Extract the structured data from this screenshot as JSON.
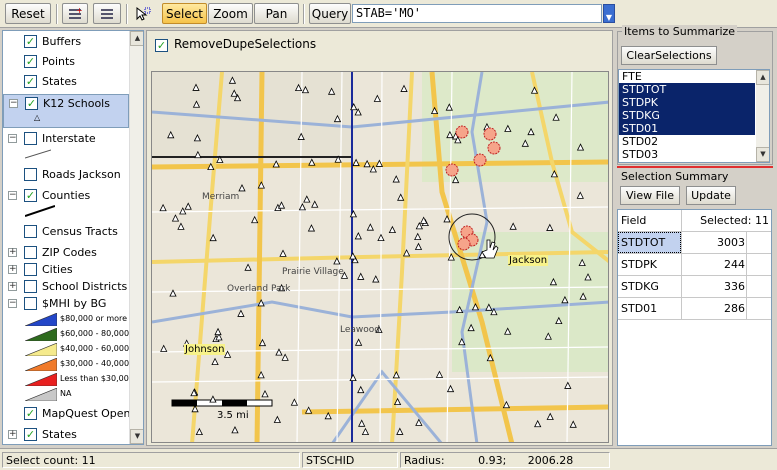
{
  "toolbar": {
    "reset": "Reset",
    "select": "Select",
    "zoom": "Zoom",
    "pan": "Pan",
    "query": "Query",
    "query_value": "STAB='MO'"
  },
  "layers": [
    {
      "label": "Buffers",
      "checked": true
    },
    {
      "label": "Points",
      "checked": true
    },
    {
      "label": "States",
      "checked": true
    },
    {
      "label": "K12 Schools",
      "checked": true
    },
    {
      "label": "Interstate",
      "checked": false
    },
    {
      "label": "Roads Jackson",
      "checked": false
    },
    {
      "label": "Counties",
      "checked": true
    },
    {
      "label": "Census Tracts",
      "checked": false
    },
    {
      "label": "ZIP Codes",
      "checked": false
    },
    {
      "label": "Cities",
      "checked": false
    },
    {
      "label": "School Districts",
      "checked": false
    },
    {
      "label": "$MHI by BG",
      "checked": false
    },
    {
      "label": "MapQuest OpenSt",
      "checked": true
    },
    {
      "label": "States",
      "checked": true
    }
  ],
  "legend": [
    {
      "label": "$80,000 or more",
      "color": "#2346c8"
    },
    {
      "label": "$60,000 - 80,000",
      "color": "#2e6b1e"
    },
    {
      "label": "$40,000 - 60,000",
      "color": "#f5ea8c"
    },
    {
      "label": "$30,000 - 40,000",
      "color": "#f07a2a"
    },
    {
      "label": "Less than $30,000",
      "color": "#e82020"
    },
    {
      "label": "NA",
      "color": "#c8c8c8"
    }
  ],
  "map": {
    "remove_dupe_label": "RemoveDupeSelections",
    "remove_dupe_checked": true,
    "label_johnson": "Johnson",
    "label_jackson": "Jackson",
    "scale_label": "3.5 mi",
    "place_labels": [
      "Merriam",
      "Overland Park",
      "Prairie Village",
      "Leawood"
    ]
  },
  "items": {
    "title": "Items to Summarize",
    "clear_button": "ClearSelections",
    "list": [
      {
        "label": "FTE",
        "selected": false
      },
      {
        "label": "STDTOT",
        "selected": true
      },
      {
        "label": "STDPK",
        "selected": true
      },
      {
        "label": "STDKG",
        "selected": true
      },
      {
        "label": "STD01",
        "selected": true
      },
      {
        "label": "STD02",
        "selected": false
      },
      {
        "label": "STD03",
        "selected": false
      }
    ]
  },
  "summary": {
    "title": "Selection Summary",
    "view_file": "View File",
    "update": "Update",
    "header_field": "Field",
    "header_selected": "Selected: 11",
    "rows": [
      {
        "field": "STDTOT",
        "value": "3003"
      },
      {
        "field": "STDPK",
        "value": "244"
      },
      {
        "field": "STDKG",
        "value": "336"
      },
      {
        "field": "STD01",
        "value": "286"
      }
    ]
  },
  "status": {
    "count": "Select count: 11",
    "field": "STSCHID",
    "radius_label": "Radius:",
    "radius_value": "0.93;",
    "radius_extra": "2006.28"
  }
}
